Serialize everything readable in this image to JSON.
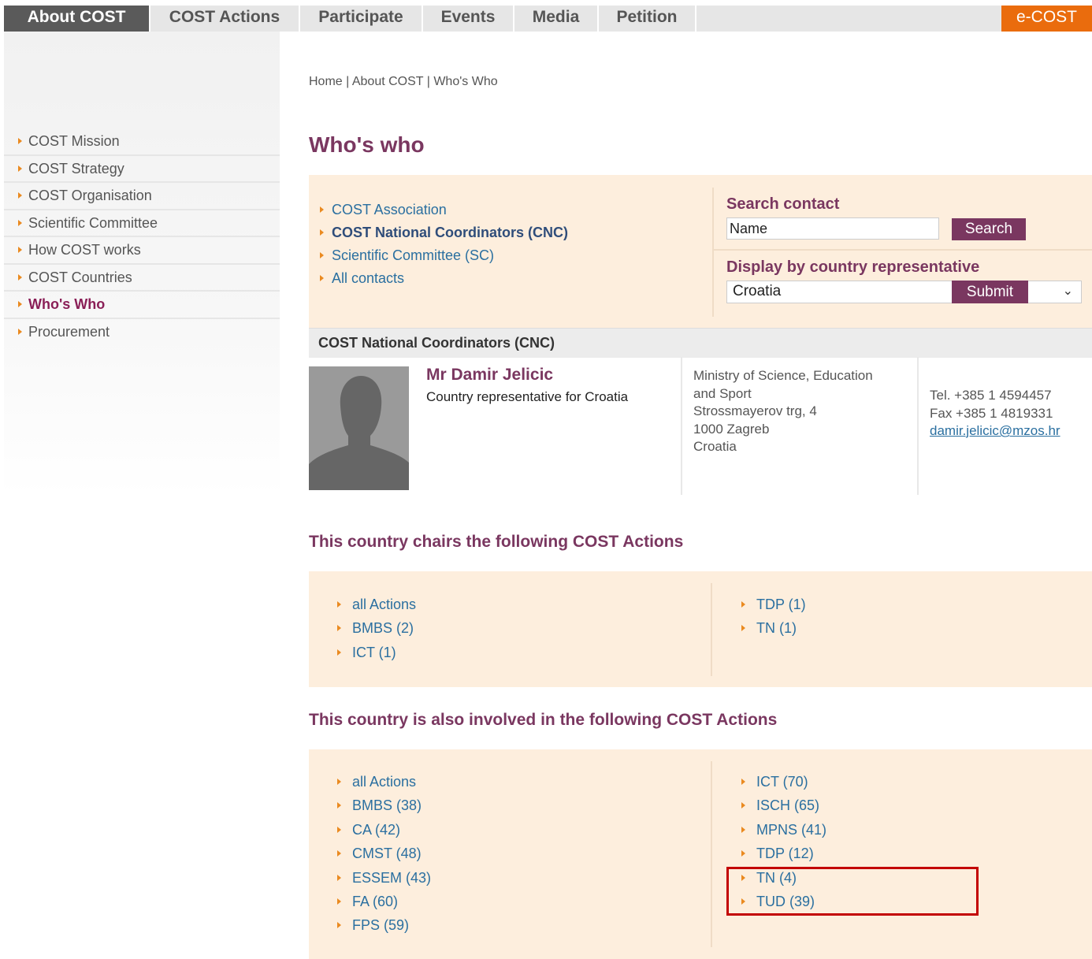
{
  "topnav": {
    "tabs": [
      "About COST",
      "COST Actions",
      "Participate",
      "Events",
      "Media",
      "Petition"
    ],
    "ecost": "e-COST"
  },
  "sidebar": {
    "items": [
      {
        "label": "COST Mission"
      },
      {
        "label": "COST Strategy"
      },
      {
        "label": "COST Organisation"
      },
      {
        "label": "Scientific Committee"
      },
      {
        "label": "How COST works"
      },
      {
        "label": "COST Countries"
      },
      {
        "label": "Who's Who",
        "active": true
      },
      {
        "label": "Procurement"
      }
    ]
  },
  "breadcrumb": {
    "home": "Home",
    "sep": " | ",
    "about": "About COST",
    "current": "Who's Who"
  },
  "page_title": "Who's who",
  "filter": {
    "links": [
      "COST Association",
      "COST National Coordinators (CNC)",
      "Scientific Committee (SC)",
      "All contacts"
    ],
    "search_label": "Search contact",
    "search_value": "Name",
    "search_button": "Search",
    "country_label": "Display by country representative",
    "country_value": "Croatia",
    "submit_button": "Submit"
  },
  "cnc_header": "COST National Coordinators (CNC)",
  "person": {
    "name": "Mr Damir Jelicic",
    "role": "Country representative for Croatia",
    "address": [
      "Ministry of Science, Education",
      "and Sport",
      "Strossmayerov trg, 4",
      "1000 Zagreb",
      "Croatia"
    ],
    "tel": "Tel. +385 1 4594457",
    "fax": "Fax +385 1 4819331",
    "email": "damir.jelicic@mzos.hr"
  },
  "chairs": {
    "title": "This country chairs the following COST Actions",
    "left": [
      "all Actions",
      "BMBS (2)",
      "ICT (1)"
    ],
    "right": [
      "TDP (1)",
      "TN (1)"
    ]
  },
  "involved": {
    "title": "This country is also involved in the following COST Actions",
    "left": [
      "all Actions",
      "BMBS (38)",
      "CA (42)",
      "CMST (48)",
      "ESSEM (43)",
      "FA (60)",
      "FPS (59)"
    ],
    "right": [
      "ICT (70)",
      "ISCH (65)",
      "MPNS (41)",
      "TDP (12)",
      "TN (4)",
      "TUD (39)"
    ]
  },
  "colors": {
    "accent": "#7a3760",
    "orange": "#ea6c0d",
    "link": "#2a6fa0",
    "panel": "#fdeedd",
    "highlight": "#c30000"
  }
}
